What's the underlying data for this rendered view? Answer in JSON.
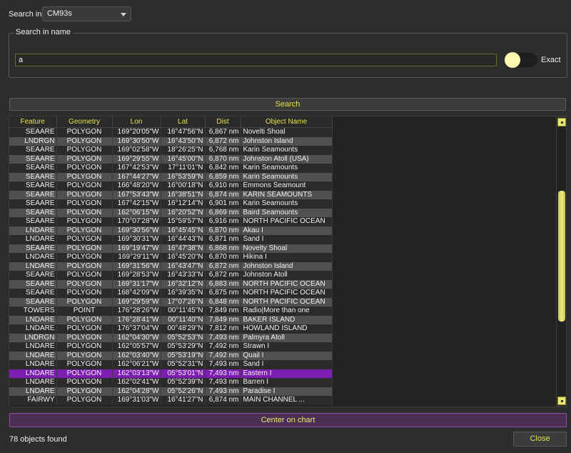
{
  "search_in": {
    "label": "Search in",
    "selected": "CM93s"
  },
  "name_group": {
    "title": "Search in name",
    "input_value": "a",
    "exact_label": "Exact"
  },
  "search_button": "Search",
  "columns": [
    "Feature",
    "Geometry",
    "Lon",
    "Lat",
    "Dist",
    "Object Name"
  ],
  "rows": [
    [
      "SEAARE",
      "POLYGON",
      "169°20'05\"W",
      "16°47'56\"N",
      "6,867 nm",
      "Novelti Shoal"
    ],
    [
      "LNDRGN",
      "POLYGON",
      "169°30'50\"W",
      "16°43'50\"N",
      "6,872 nm",
      "Johnston Island"
    ],
    [
      "SEAARE",
      "POLYGON",
      "169°02'58\"W",
      "18°26'25\"N",
      "6,768 nm",
      "Karin Seamounts"
    ],
    [
      "SEAARE",
      "POLYGON",
      "169°29'55\"W",
      "16°45'00\"N",
      "6,870 nm",
      "Johnston Atoll (USA)"
    ],
    [
      "SEAARE",
      "POLYGON",
      "167°42'53\"W",
      "17°11'01\"N",
      "6,842 nm",
      "Karin Seamounts"
    ],
    [
      "SEAARE",
      "POLYGON",
      "167°44'27\"W",
      "16°53'59\"N",
      "6,859 nm",
      "Karin Seamounts"
    ],
    [
      "SEAARE",
      "POLYGON",
      "166°48'20\"W",
      "16°00'18\"N",
      "6,910 nm",
      "Emmons Seamount"
    ],
    [
      "SEAARE",
      "POLYGON",
      "167°53'43\"W",
      "16°38'51\"N",
      "6,874 nm",
      "KARIN SEAMOUNTS"
    ],
    [
      "SEAARE",
      "POLYGON",
      "167°42'15\"W",
      "16°12'14\"N",
      "6,901 nm",
      "Karin Seamounts"
    ],
    [
      "SEAARE",
      "POLYGON",
      "162°06'15\"W",
      "16°20'52\"N",
      "6,869 nm",
      "Baird Seamounts"
    ],
    [
      "SEAARE",
      "POLYGON",
      "170°07'28\"W",
      "15°59'57\"N",
      "6,916 nm",
      "NORTH PACIFIC OCEAN"
    ],
    [
      "LNDARE",
      "POLYGON",
      "169°30'56\"W",
      "16°45'45\"N",
      "6,870 nm",
      "Akau I"
    ],
    [
      "LNDARE",
      "POLYGON",
      "169°30'31\"W",
      "16°44'43\"N",
      "6,871 nm",
      "Sand I"
    ],
    [
      "SEAARE",
      "POLYGON",
      "169°19'47\"W",
      "16°47'38\"N",
      "6,868 nm",
      "Novelty Shoal"
    ],
    [
      "LNDARE",
      "POLYGON",
      "169°29'11\"W",
      "16°45'20\"N",
      "6,870 nm",
      "Hikina I"
    ],
    [
      "LNDARE",
      "POLYGON",
      "169°31'56\"W",
      "16°43'47\"N",
      "6,872 nm",
      "Johnston Island"
    ],
    [
      "SEAARE",
      "POLYGON",
      "169°28'53\"W",
      "16°43'33\"N",
      "6,872 nm",
      "Johnston Atoll"
    ],
    [
      "SEAARE",
      "POLYGON",
      "169°31'17\"W",
      "16°32'12\"N",
      "6,883 nm",
      "NORTH PACIFIC OCEAN"
    ],
    [
      "SEAARE",
      "POLYGON",
      "168°42'09\"W",
      "16°39'35\"N",
      "6,875 nm",
      "NORTH PACIFIC OCEAN"
    ],
    [
      "SEAARE",
      "POLYGON",
      "169°29'59\"W",
      "17°07'26\"N",
      "6,848 nm",
      "NORTH PACIFIC OCEAN"
    ],
    [
      "TOWERS",
      "POINT",
      "176°28'26\"W",
      "00°11'45\"N",
      "7,849 nm",
      "Radio|More than one"
    ],
    [
      "LNDARE",
      "POLYGON",
      "176°28'41\"W",
      "00°11'40\"N",
      "7,849 nm",
      "BAKER ISLAND"
    ],
    [
      "LNDARE",
      "POLYGON",
      "176°37'04\"W",
      "00°48'29\"N",
      "7,812 nm",
      "HOWLAND ISLAND"
    ],
    [
      "LNDRGN",
      "POLYGON",
      "162°04'30\"W",
      "05°52'53\"N",
      "7,493 nm",
      "Palmyra Atoll"
    ],
    [
      "LNDARE",
      "POLYGON",
      "162°05'57\"W",
      "05°53'29\"N",
      "7,492 nm",
      "Strawn I"
    ],
    [
      "LNDARE",
      "POLYGON",
      "162°03'40\"W",
      "05°53'19\"N",
      "7,492 nm",
      "Quail I"
    ],
    [
      "LNDARE",
      "POLYGON",
      "162°06'21\"W",
      "05°52'31\"N",
      "7,493 nm",
      "Sand I"
    ],
    [
      "LNDARE",
      "POLYGON",
      "162°03'13\"W",
      "05°53'01\"N",
      "7,493 nm",
      "Eastern I"
    ],
    [
      "LNDARE",
      "POLYGON",
      "162°02'41\"W",
      "05°52'39\"N",
      "7,493 nm",
      "Barren I"
    ],
    [
      "LNDARE",
      "POLYGON",
      "162°04'28\"W",
      "05°52'26\"N",
      "7,493 nm",
      "Paradise I"
    ],
    [
      "FAIRWY",
      "POLYGON",
      "169°31'03\"W",
      "16°41'27\"N",
      "6,874 nm",
      "MAIN CHANNEL ..."
    ]
  ],
  "selected_row_index": 27,
  "center_button": "Center on chart",
  "status": "78 objects found",
  "close_button": "Close",
  "colors": {
    "accent": "#e6e14a",
    "selection": "#7c1fb0",
    "background": "#2d2d2d"
  }
}
